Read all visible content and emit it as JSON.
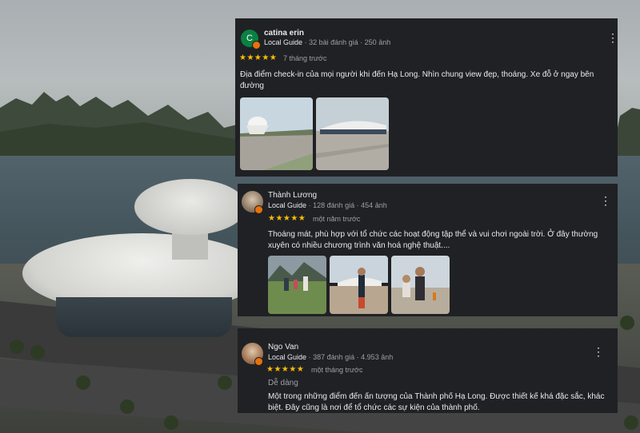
{
  "reviews": [
    {
      "author": "catina erin",
      "avatar_letter": "C",
      "avatar_color": "#0b8043",
      "guide_label": "Local Guide",
      "review_count": "32 bài đánh giá",
      "photo_count": "250 ảnh",
      "stars": "★★★★★",
      "rating": 5,
      "time": "7 tháng trước",
      "text": "Địa điểm check-in của mọi người khi đến Hạ Long. Nhìn chung view đẹp, thoáng. Xe đỗ ở ngay bên đường",
      "photos": [
        "photo-plaza-sculpture",
        "photo-plaza-theater"
      ]
    },
    {
      "author": "Thành Lương",
      "guide_label": "Local Guide",
      "review_count": "128 đánh giá",
      "photo_count": "454 ảnh",
      "stars": "★★★★★",
      "rating": 5,
      "time": "một năm trước",
      "text": "Thoáng mát, phù hợp với tổ chức các hoạt động tập thể và vui chơi ngoài trời. Ở đây thường xuyên có nhiều chương trình văn hoá nghệ thuật....",
      "photos": [
        "photo-park-family",
        "photo-child-plaza",
        "photo-father-child"
      ]
    },
    {
      "author": "Ngo Van",
      "guide_label": "Local Guide",
      "review_count": "387 đánh giá",
      "photo_count": "4.953 ảnh",
      "stars": "★★★★★",
      "rating": 5,
      "time": "một tháng trước",
      "subtitle": "Dễ dàng",
      "text": "Một trong những điểm đến ấn tượng của Thành phố Hạ Long. Được thiết kế khá đặc sắc, khác biệt. Đây cũng là nơi để tổ chức các sự kiện của thành phố."
    }
  ],
  "separator": "·",
  "more_icon": "⋮",
  "colors": {
    "card_bg": "#202124",
    "star": "#fbbc04",
    "badge": "#e8710a",
    "muted_text": "#9aa0a6"
  }
}
